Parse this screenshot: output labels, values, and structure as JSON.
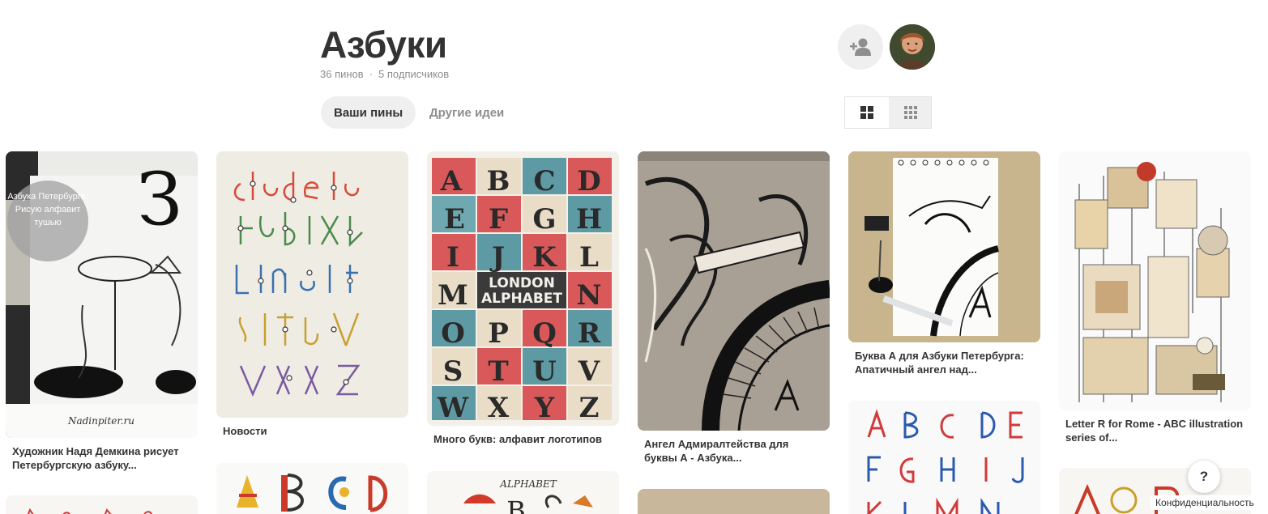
{
  "board": {
    "title": "Азбуки",
    "pins_count": "36 пинов",
    "separator": "·",
    "followers_count": "5 подписчиков"
  },
  "tabs": [
    {
      "label": "Ваши пины",
      "active": true
    },
    {
      "label": "Другие идеи",
      "active": false
    }
  ],
  "view_toggle": {
    "options": [
      "grid-large-icon",
      "grid-small-icon"
    ],
    "selected": 0
  },
  "pins": [
    {
      "caption": "Художник Надя Демкина рисует Петербургскую азбуку...",
      "overlay_text": "Азбука Петербурга: Рисую алфавит тушью",
      "big_letter": "З",
      "watermark": "Nadinpiter.ru"
    },
    {
      "caption": "Новости"
    },
    {
      "caption": "Много букв: алфавит логотипов",
      "poster_line1": "LONDON",
      "poster_line2": "ALPHABET"
    },
    {
      "caption": "Ангел Адмиралтейства для буквы А - Азбука..."
    },
    {
      "caption": "Буква А для Азбуки Петербурга: Апатичный ангел над..."
    },
    {
      "caption": "Letter R for Rome - ABC illustration series of..."
    }
  ],
  "bottom_pins": [
    {
      "title_text": "ALPHABET"
    }
  ],
  "help": {
    "label": "?"
  },
  "privacy": {
    "label": "Конфиденциальность"
  },
  "colors": {
    "gray_bg": "#efefef",
    "text_dark": "#333333",
    "text_muted": "#8e8e8e"
  }
}
